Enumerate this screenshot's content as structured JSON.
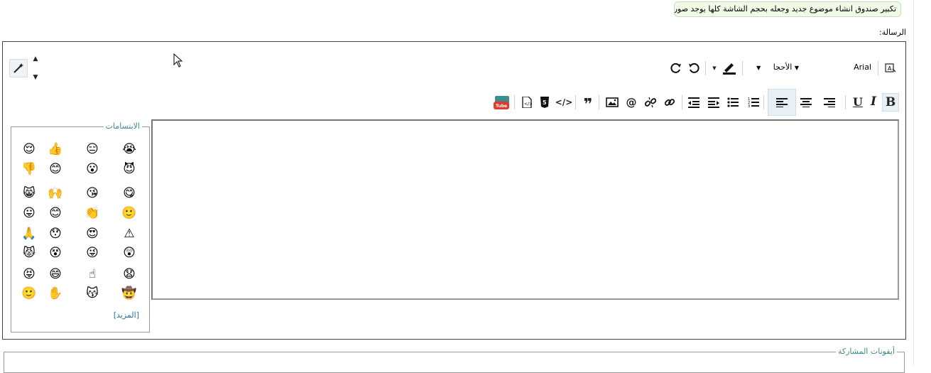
{
  "notice": {
    "text": "تكبير صندوق انشاء موضوع جديد وجعله بحجم الشاشة كلها يوجد صور"
  },
  "editor": {
    "message_label": "الرسالة:",
    "font_name": "Arial",
    "font_size": "الأحجا",
    "textarea_value": ""
  },
  "smilies": {
    "legend": "الابتسامات",
    "more_label": "[المزيد]",
    "items": [
      "😭",
      "😑",
      "👍",
      "😌",
      "😈",
      "😮",
      "😊",
      "👎",
      "😋",
      "😘",
      "🙌",
      "😸",
      "🙂",
      "👏",
      "😊",
      "😛",
      "⚠",
      "😍",
      "😯",
      "🙏",
      "😲",
      "😜",
      "😵",
      "😾",
      "😧",
      "☝",
      "😄",
      "😝",
      "🤠",
      "😽",
      "✋",
      "🙂"
    ]
  },
  "share": {
    "legend": "أيقونات المشاركة"
  },
  "colors": {
    "accent": "#3c8a8a",
    "frame": "#444444",
    "notice_bg": "#f1fae7"
  }
}
